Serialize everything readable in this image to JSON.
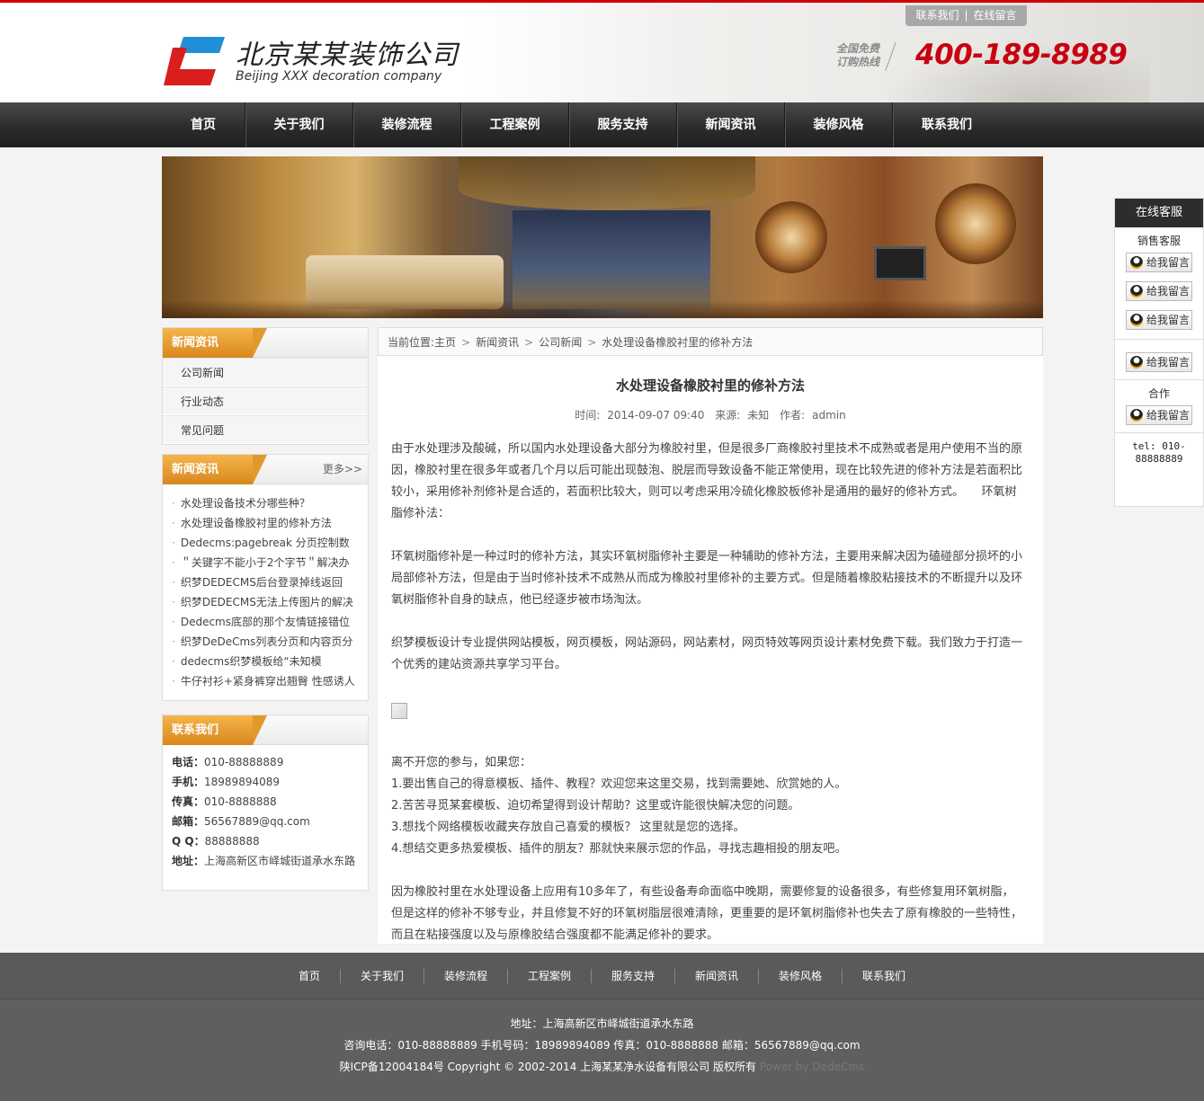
{
  "header": {
    "logo_title": "北京某某装饰公司",
    "logo_subtitle": "Beijing XXX decoration company",
    "top_links": [
      "联系我们",
      "在线留言"
    ],
    "hotline_label_1": "全国免费",
    "hotline_label_2": "订购热线",
    "hotline_number": "400-189-8989",
    "colors": {
      "accent_red": "#c8000f",
      "logo_blue": "#1f8fd8",
      "logo_red": "#d91e1e"
    }
  },
  "nav": [
    "首页",
    "关于我们",
    "装修流程",
    "工程案例",
    "服务支持",
    "新闻资讯",
    "装修风格",
    "联系我们"
  ],
  "sidebar": {
    "categories": {
      "title": "新闻资讯",
      "items": [
        "公司新闻",
        "行业动态",
        "常见问题"
      ]
    },
    "news": {
      "title": "新闻资讯",
      "more": "更多>>",
      "items": [
        "水处理设备技术分哪些种？",
        "水处理设备橡胶衬里的修补方法",
        "Dedecms:pagebreak 分页控制数",
        "＂关键字不能小于2个字节＂解决办",
        "织梦DEDECMS后台登录掉线返回",
        "织梦DEDECMS无法上传图片的解决",
        "Dedecms底部的那个友情链接错位",
        "织梦DeDeCms列表分页和内容页分",
        "dedecms织梦模板给“未知模",
        "牛仔衬衫+紧身裤穿出翘臀 性感诱人"
      ]
    },
    "contact": {
      "title": "联系我们",
      "items": [
        {
          "label": "电话：",
          "value": "010-88888889"
        },
        {
          "label": "手机：",
          "value": "18989894089"
        },
        {
          "label": "传真：",
          "value": "010-8888888"
        },
        {
          "label": "邮箱：",
          "value": "56567889@qq.com"
        },
        {
          "label": "Q Q：",
          "value": "88888888"
        },
        {
          "label": "地址：",
          "value": "上海高新区市峄城街道承水东路"
        }
      ]
    }
  },
  "breadcrumb": {
    "prefix": "当前位置:",
    "items": [
      "主页",
      "新闻资讯",
      "公司新闻",
      "水处理设备橡胶衬里的修补方法"
    ],
    "separator": ">"
  },
  "article": {
    "title": "水处理设备橡胶衬里的修补方法",
    "time_label": "时间:",
    "time": "2014-09-07 09:40",
    "source_label": "来源:",
    "source": "未知",
    "author_label": "作者:",
    "author": "admin",
    "p1": "由于水处理涉及酸碱，所以国内水处理设备大部分为橡胶衬里，但是很多厂商橡胶衬里技术不成熟或者是用户使用不当的原因，橡胶衬里在很多年或者几个月以后可能出现鼓泡、脱层而导致设备不能正常使用，现在比较先进的修补方法是若面积比较小，采用修补剂修补是合适的，若面积比较大，则可以考虑采用冷硫化橡胶板修补是通用的最好的修补方式。　　环氧树脂修补法：",
    "p2": "环氧树脂修补是一种过时的修补方法，其实环氧树脂修补主要是一种辅助的修补方法，主要用来解决因为磕碰部分损坏的小局部修补方法，但是由于当时修补技术不成熟从而成为橡胶衬里修补的主要方式。但是随着橡胶粘接技术的不断提升以及环氧树脂修补自身的缺点，他已经逐步被市场淘汰。",
    "p3": "织梦模板设计专业提供网站模板，网页模板，网站源码，网站素材，网页特效等网页设计素材免费下载。我们致力于打造一个优秀的建站资源共享学习平台。",
    "list_intro": "离不开您的参与，如果您：",
    "list": [
      "1.要出售自己的得意模板、插件、教程？欢迎您来这里交易，找到需要她、欣赏她的人。",
      "2.苦苦寻觅某套模板、迫切希望得到设计帮助？这里或许能很快解决您的问题。",
      "3.想找个网络模板收藏夹存放自己喜爱的模板？ 这里就是您的选择。",
      "4.想结交更多热爱模板、插件的朋友？那就快来展示您的作品，寻找志趣相投的朋友吧。"
    ],
    "p4": "因为橡胶衬里在水处理设备上应用有10多年了，有些设备寿命面临中晚期，需要修复的设备很多，有些修复用环氧树脂，但是这样的修补不够专业，并且修复不好的环氧树脂层很难清除，更重要的是环氧树脂修补也失去了原有橡胶的一些特性，而且在粘接强度以及与原橡胶结合强度都不能满足修补的要求。"
  },
  "online_service": {
    "title": "在线客服",
    "sales_label": "销售客服",
    "button_label": "给我留言",
    "coop_label": "合作",
    "tel_line1": "tel: 010-",
    "tel_line2": "88888889"
  },
  "footer": {
    "nav": [
      "首页",
      "关于我们",
      "装修流程",
      "工程案例",
      "服务支持",
      "新闻资讯",
      "装修风格",
      "联系我们"
    ],
    "address": "地址：上海高新区市峄城街道承水东路",
    "contact_line": "咨询电话：010-88888889 手机号码：18989894089 传真：010-8888888 邮箱：56567889@qq.com",
    "copyright": "陕ICP备12004184号 Copyright © 2002-2014 上海某某净水设备有限公司 版权所有",
    "power": "Power by DedeCms"
  }
}
